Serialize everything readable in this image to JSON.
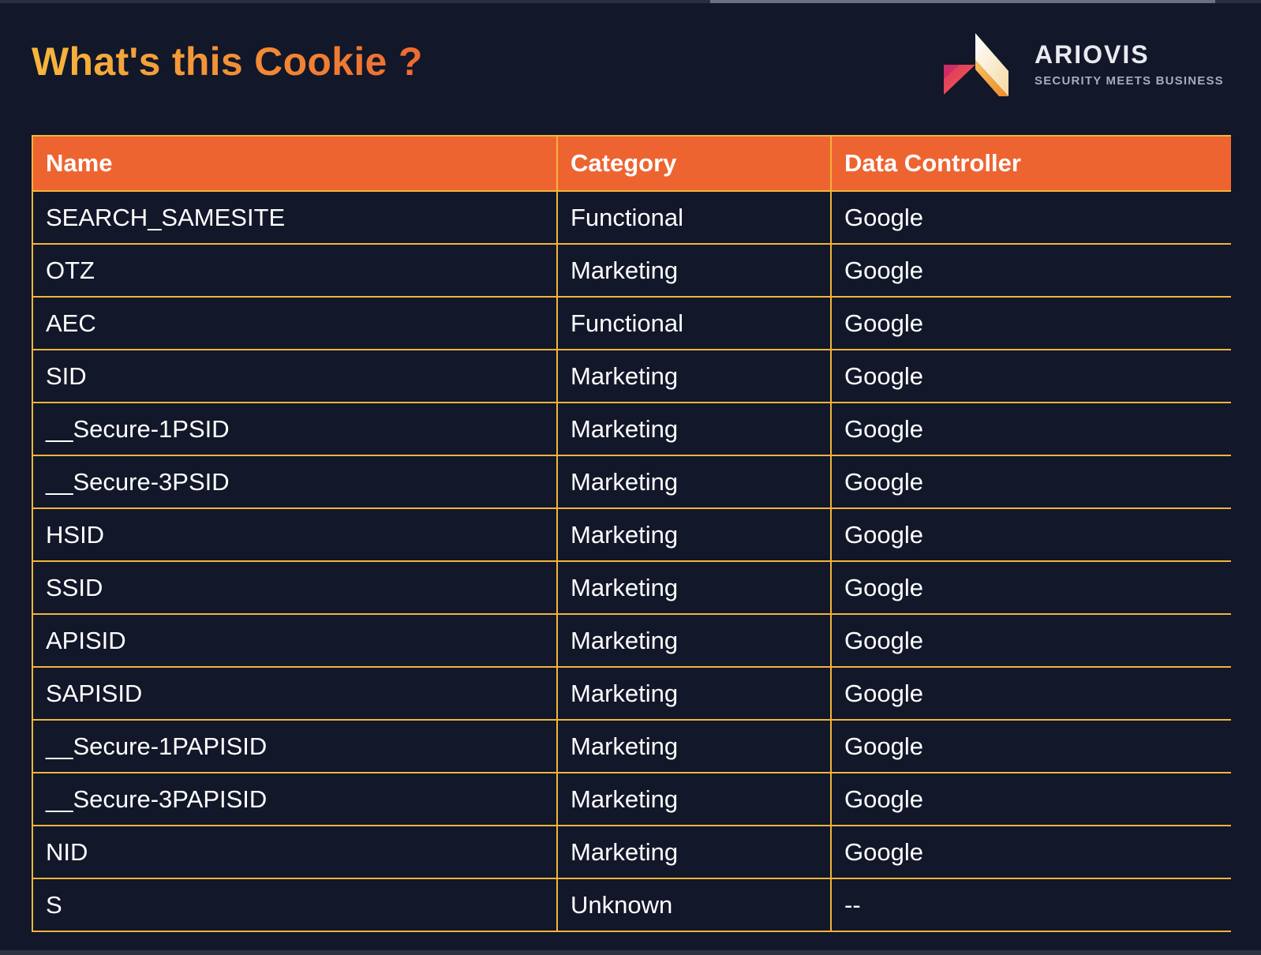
{
  "header": {
    "title": "What's this Cookie ?"
  },
  "brand": {
    "name": "ARIOVIS",
    "tagline": "SECURITY MEETS BUSINESS",
    "icon": "ariovis-logo-icon"
  },
  "colors": {
    "background": "#121729",
    "header_row": "#ee6431",
    "border": "#f2b53a",
    "title_gradient_start": "#f6b73c",
    "title_gradient_end": "#ef6a31"
  },
  "table": {
    "columns": [
      "Name",
      "Category",
      "Data Controller"
    ],
    "rows": [
      [
        "SEARCH_SAMESITE",
        "Functional",
        "Google"
      ],
      [
        "OTZ",
        "Marketing",
        "Google"
      ],
      [
        "AEC",
        "Functional",
        "Google"
      ],
      [
        "SID",
        "Marketing",
        "Google"
      ],
      [
        "__Secure-1PSID",
        "Marketing",
        "Google"
      ],
      [
        "__Secure-3PSID",
        "Marketing",
        "Google"
      ],
      [
        "HSID",
        "Marketing",
        "Google"
      ],
      [
        "SSID",
        "Marketing",
        "Google"
      ],
      [
        "APISID",
        "Marketing",
        "Google"
      ],
      [
        "SAPISID",
        "Marketing",
        "Google"
      ],
      [
        "__Secure-1PAPISID",
        "Marketing",
        "Google"
      ],
      [
        "__Secure-3PAPISID",
        "Marketing",
        "Google"
      ],
      [
        "NID",
        "Marketing",
        "Google"
      ],
      [
        "S",
        "Unknown",
        "--"
      ]
    ]
  }
}
